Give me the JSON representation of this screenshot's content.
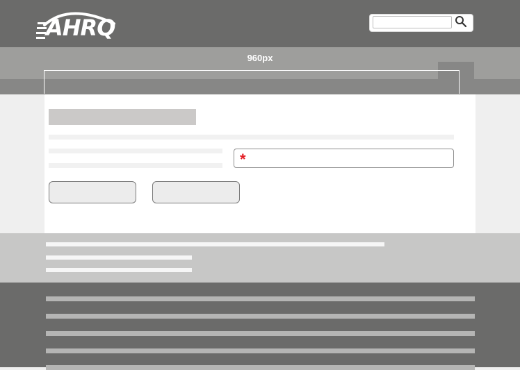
{
  "header": {
    "logo_text": "AHRQ",
    "search": {
      "value": "",
      "placeholder": "",
      "button_icon": "search-icon"
    }
  },
  "nav": {
    "width_label": "960px"
  },
  "form": {
    "required_marker": "*",
    "button_1_label": "",
    "button_2_label": ""
  },
  "colors": {
    "header_bg": "#6b6b6a",
    "nav_bg": "#9e9e9c",
    "required_star": "#e31b23",
    "footer_upper_bg": "#c7c7c6",
    "footer_lower_bg": "#6b6b6a"
  }
}
